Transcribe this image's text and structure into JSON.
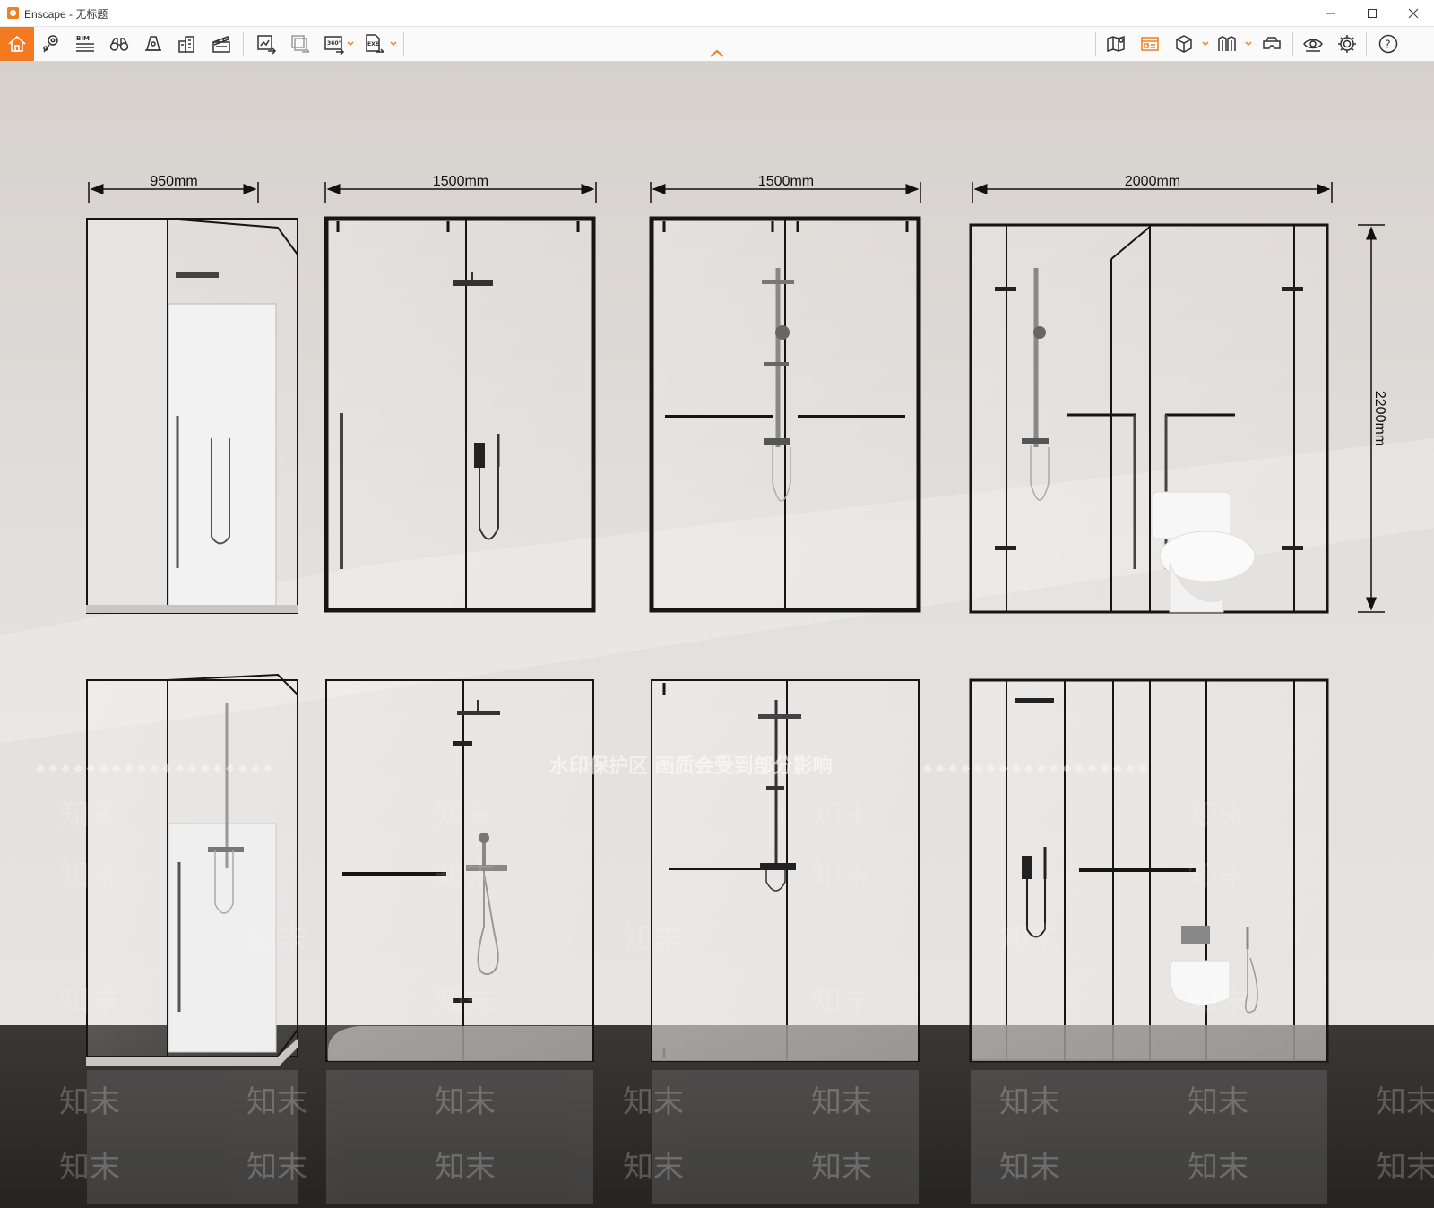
{
  "window": {
    "app_title": "Enscape - 无标题",
    "controls": [
      "minimize",
      "maximize",
      "close"
    ]
  },
  "toolbar": {
    "left_icons": [
      "home-icon",
      "location-pin-icon",
      "bim-icon",
      "binoculars-icon",
      "bell-icon",
      "buildings-icon",
      "clapperboard-icon",
      "screenshot-export-icon",
      "batch-render-icon",
      "panorama-360-icon",
      "exe-export-icon"
    ],
    "bim_label": "BIM",
    "pano_label": "360°",
    "exe_label": "EXE",
    "right_icons": [
      "map-icon",
      "asset-library-icon",
      "cube-view-icon",
      "visual-settings-icon",
      "vr-headset-icon",
      "eye-icon",
      "gear-icon",
      "help-icon"
    ],
    "help_label": "?",
    "accent_color": "#f37a20"
  },
  "scene": {
    "dimensions": {
      "widths": [
        "950mm",
        "1500mm",
        "1500mm",
        "2000mm"
      ],
      "height": "2200mm"
    },
    "watermark": {
      "banner": "水印保护区  画质会受到部分影响",
      "brand": "知末"
    },
    "colors": {
      "wall": "#dcd8d4",
      "floor": "#2e2c2b",
      "frame": "#151515"
    }
  }
}
